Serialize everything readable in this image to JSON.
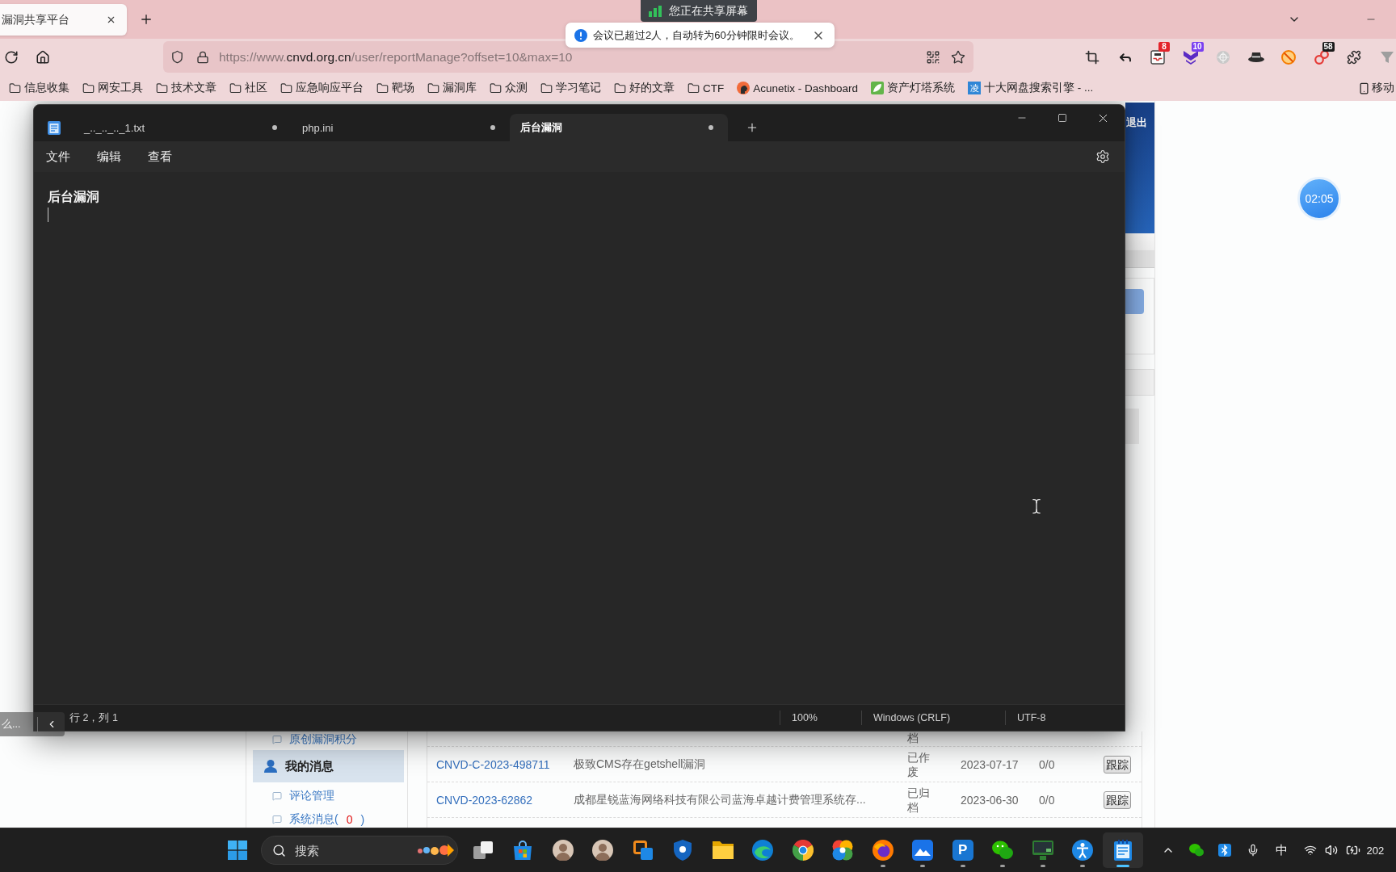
{
  "browser": {
    "tabs": [
      {
        "title": "漏洞共享平台",
        "selected": true
      }
    ],
    "address": {
      "url": "https://www.**cnvd.org.cn**/user/reportManage?offset=10&max=10"
    },
    "extensions": [
      {
        "kind": "crop"
      },
      {
        "kind": "reply"
      },
      {
        "kind": "tray",
        "badge": "8",
        "color": "#e3242b"
      },
      {
        "kind": "down-arrow",
        "badge": "10",
        "color": "#7a3ff0"
      },
      {
        "kind": "crosshair-circle"
      },
      {
        "kind": "hat"
      },
      {
        "kind": "blocked"
      },
      {
        "kind": "rings",
        "badge": "58",
        "color": "#1a1a1a"
      },
      {
        "kind": "puzzle"
      },
      {
        "kind": "funnel"
      }
    ],
    "bookmarks": [
      {
        "kind": "folder",
        "label": "信息收集"
      },
      {
        "kind": "folder",
        "label": "网安工具"
      },
      {
        "kind": "folder",
        "label": "技术文章"
      },
      {
        "kind": "folder",
        "label": "社区"
      },
      {
        "kind": "folder",
        "label": "应急响应平台"
      },
      {
        "kind": "folder",
        "label": "靶场"
      },
      {
        "kind": "folder",
        "label": "漏洞库"
      },
      {
        "kind": "folder",
        "label": "众测"
      },
      {
        "kind": "folder",
        "label": "学习笔记"
      },
      {
        "kind": "folder",
        "label": "好的文章"
      },
      {
        "kind": "folder",
        "label": "CTF"
      },
      {
        "kind": "head",
        "label": "Acunetix - Dashboard"
      },
      {
        "kind": "leaf",
        "label": "资产灯塔系统"
      },
      {
        "kind": "glyph",
        "glyph": "凌",
        "label": "十大网盘搜索引擎 - ..."
      },
      {
        "kind": "phone",
        "label": "移动"
      }
    ]
  },
  "share_banner": {
    "label": "您正在共享屏幕"
  },
  "notification": {
    "message": "会议已超过2人，自动转为60分钟限时会议。"
  },
  "page": {
    "logout": "退出",
    "sidebar": [
      {
        "kind": "link",
        "label": "原创漏洞积分"
      },
      {
        "kind": "section",
        "label": "我的消息"
      },
      {
        "kind": "link",
        "label": "评论管理"
      },
      {
        "kind": "count-link",
        "label": "系统消息(",
        "count": "0",
        "tail": ")"
      }
    ],
    "rows": [
      {
        "kind": "partial",
        "status": "档"
      },
      {
        "kind": "full",
        "id": "CNVD-C-2023-498711",
        "title": "极致CMS存在getshell漏洞",
        "status": "已作废",
        "date": "2023-07-17",
        "score": "0/0",
        "action": "跟踪"
      },
      {
        "kind": "full",
        "id": "CNVD-2023-62862",
        "title": "成都星锐蓝海网络科技有限公司蓝海卓越计费管理系统存...",
        "status": "已归档",
        "date": "2023-06-30",
        "score": "0/0",
        "action": "跟踪"
      }
    ]
  },
  "notepad": {
    "tabs": [
      {
        "title": "_.._.._.._1.txt",
        "selected": false,
        "modified": true
      },
      {
        "title": "php.ini",
        "selected": false,
        "modified": true
      },
      {
        "title": "后台漏洞",
        "selected": true,
        "modified": true
      }
    ],
    "menu": [
      "文件",
      "编辑",
      "查看"
    ],
    "content": "后台漏洞",
    "status": {
      "position": "行 2，列 1",
      "zoom": "100%",
      "line_ending": "Windows (CRLF)",
      "encoding": "UTF-8"
    }
  },
  "side_tab": {
    "label": "么..."
  },
  "timer": "02:05",
  "taskbar": {
    "search": {
      "placeholder": "搜索"
    },
    "apps": [
      {
        "kind": "task-view",
        "running": false,
        "active": false
      },
      {
        "kind": "store",
        "running": false,
        "active": false
      },
      {
        "kind": "avatar",
        "running": false,
        "active": false
      },
      {
        "kind": "avatar",
        "running": false,
        "active": false
      },
      {
        "kind": "squares",
        "running": false,
        "active": false
      },
      {
        "kind": "shield",
        "running": false,
        "active": false
      },
      {
        "kind": "folder",
        "running": false,
        "active": false
      },
      {
        "kind": "swirl",
        "running": false,
        "active": false
      },
      {
        "kind": "tricolor",
        "running": false,
        "active": false
      },
      {
        "kind": "pinwheel",
        "running": false,
        "active": false
      },
      {
        "kind": "globe",
        "running": true,
        "active": false
      },
      {
        "kind": "mountain",
        "running": true,
        "active": false
      },
      {
        "kind": "letter",
        "glyph": "P",
        "running": true,
        "active": false
      },
      {
        "kind": "chat",
        "running": true,
        "active": false
      },
      {
        "kind": "monitor",
        "running": true,
        "active": false
      },
      {
        "kind": "person",
        "running": true,
        "active": false
      },
      {
        "kind": "notepad",
        "running": true,
        "active": true
      }
    ],
    "tray": {
      "items": [
        {
          "kind": "chevron-up"
        },
        {
          "kind": "chat"
        },
        {
          "kind": "bluetooth"
        },
        {
          "kind": "mic"
        }
      ],
      "ime": "中",
      "status": [
        {
          "kind": "wifi"
        },
        {
          "kind": "speaker"
        },
        {
          "kind": "battery"
        }
      ],
      "clock": "202"
    }
  }
}
